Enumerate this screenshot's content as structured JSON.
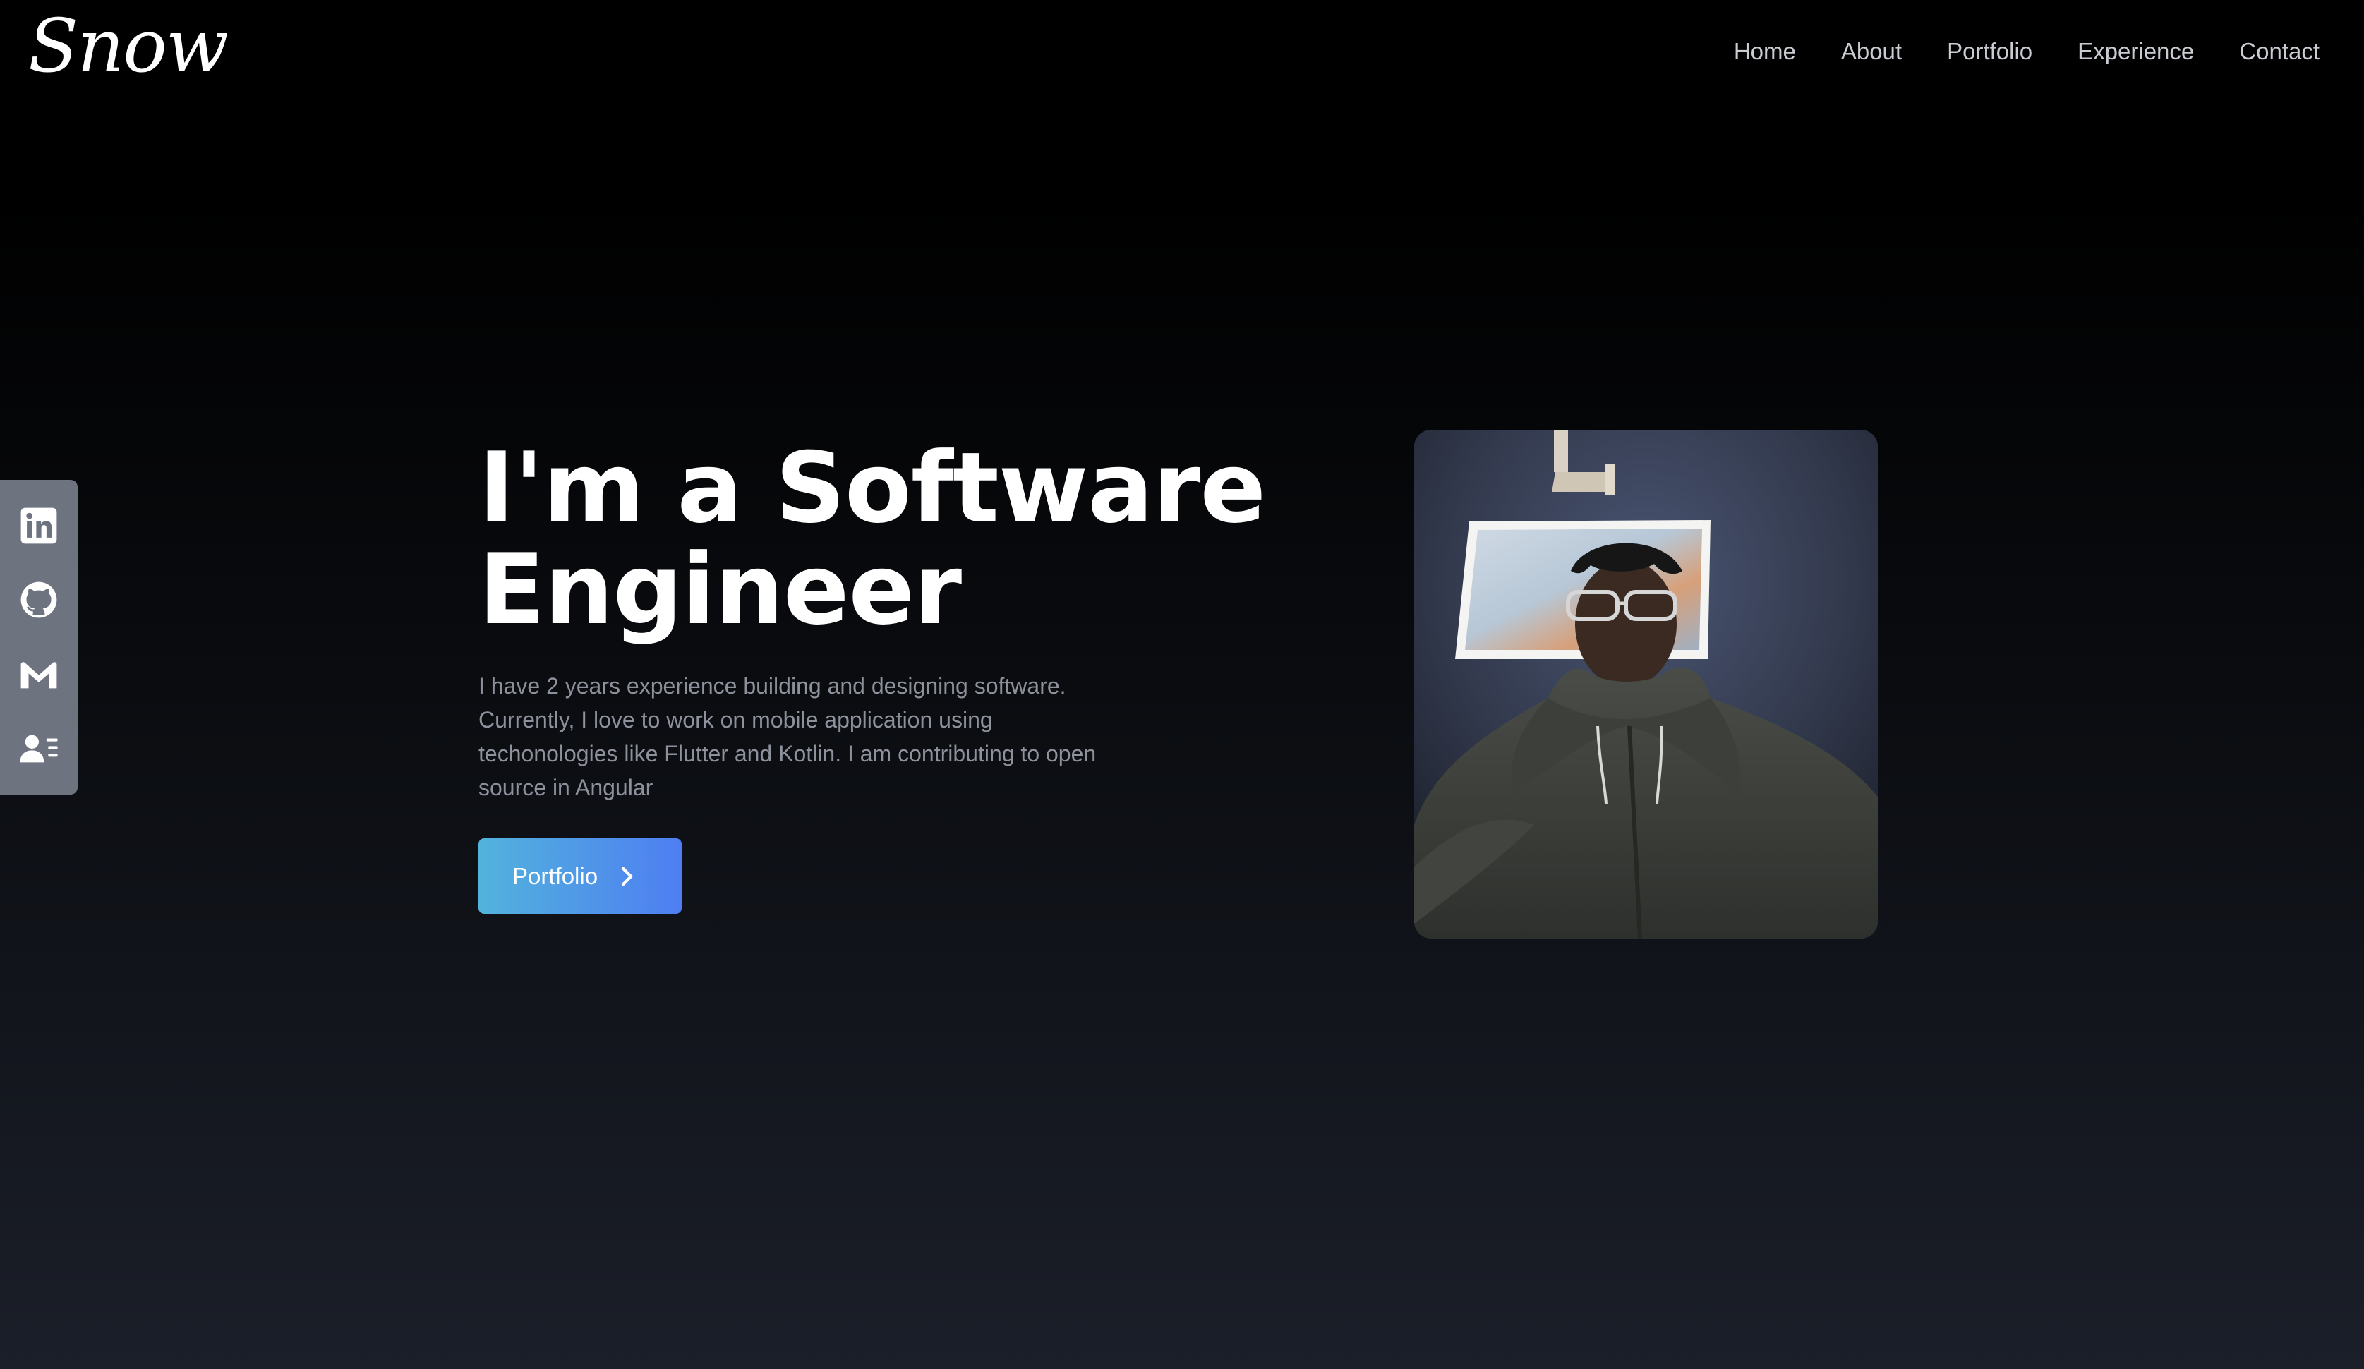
{
  "brand": {
    "logo_text": "Snow"
  },
  "nav": {
    "items": [
      {
        "label": "Home"
      },
      {
        "label": "About"
      },
      {
        "label": "Portfolio"
      },
      {
        "label": "Experience"
      },
      {
        "label": "Contact"
      }
    ]
  },
  "social": {
    "items": [
      {
        "icon": "linkedin-icon"
      },
      {
        "icon": "github-icon"
      },
      {
        "icon": "gmail-icon"
      },
      {
        "icon": "resume-icon"
      }
    ]
  },
  "hero": {
    "headline_line1": "I'm a Software",
    "headline_line2": "Engineer",
    "intro": "I have 2 years experience building and designing software. Currently, I love to work on mobile application using techonologies like Flutter and Kotlin. I am contributing to open source in Angular",
    "cta_label": "Portfolio",
    "cta_icon": "chevron-right-icon"
  },
  "profile_photo": {
    "icon": "profile-photo"
  },
  "colors": {
    "background_top": "#000000",
    "background_bottom": "#1b1f29",
    "nav_text": "#c9ccd2",
    "intro_text": "#8d919c",
    "social_bar": "#6e7380",
    "cta_gradient_start": "#52b3dc",
    "cta_gradient_end": "#4e7ef2"
  }
}
